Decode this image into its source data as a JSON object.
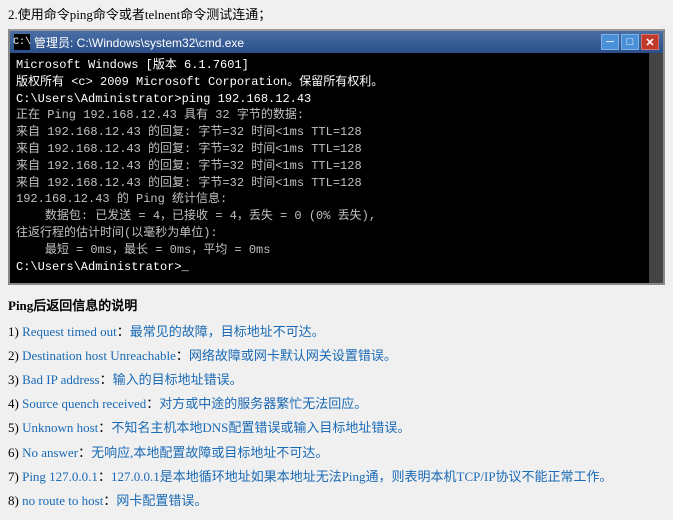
{
  "instruction": "2.使用命令ping命令或者telnent命令测试连通；",
  "window": {
    "title": "管理员: C:\\Windows\\system32\\cmd.exe",
    "content": [
      {
        "text": "Microsoft Windows [版本 6.1.7601]",
        "color": "white"
      },
      {
        "text": "版权所有 <c> 2009 Microsoft Corporation。保留所有权利。",
        "color": "white"
      },
      {
        "text": ""
      },
      {
        "text": "C:\\Users\\Administrator>ping 192.168.12.43",
        "color": "white"
      },
      {
        "text": ""
      },
      {
        "text": "正在 Ping 192.168.12.43 具有 32 字节的数据:",
        "color": "gray"
      },
      {
        "text": "来自 192.168.12.43 的回复: 字节=32 时间<1ms TTL=128",
        "color": "gray"
      },
      {
        "text": "来自 192.168.12.43 的回复: 字节=32 时间<1ms TTL=128",
        "color": "gray"
      },
      {
        "text": "来自 192.168.12.43 的回复: 字节=32 时间<1ms TTL=128",
        "color": "gray"
      },
      {
        "text": "来自 192.168.12.43 的回复: 字节=32 时间<1ms TTL=128",
        "color": "gray"
      },
      {
        "text": ""
      },
      {
        "text": "192.168.12.43 的 Ping 统计信息:",
        "color": "gray"
      },
      {
        "text": "    数据包: 已发送 = 4，已接收 = 4，丢失 = 0 (0% 丢失),",
        "color": "gray"
      },
      {
        "text": "往返行程的估计时间(以毫秒为单位):",
        "color": "gray"
      },
      {
        "text": "    最短 = 0ms，最长 = 0ms，平均 = 0ms",
        "color": "gray"
      },
      {
        "text": ""
      },
      {
        "text": "C:\\Users\\Administrator>_",
        "color": "white"
      }
    ]
  },
  "ping_title": "Ping后返回信息的说明",
  "ping_items": [
    {
      "num": "1)",
      "label": "Request timed out",
      "colon": "：",
      "text": "最常见的故障，目标地址不可达。"
    },
    {
      "num": "2)",
      "label": "Destination host Unreachable",
      "colon": "：",
      "text": "网络故障或网卡默认网关设置错误。"
    },
    {
      "num": "3)",
      "label": "Bad IP address",
      "colon": "：",
      "text": "输入的目标地址错误。"
    },
    {
      "num": "4)",
      "label": "Source quench received",
      "colon": "：",
      "text": "对方或中途的服务器繁忙无法回应。"
    },
    {
      "num": "5)",
      "label": "Unknown host",
      "colon": "：",
      "text": "不知名主机本地DNS配置错误或输入目标地址错误。"
    },
    {
      "num": "6)",
      "label": "No answer",
      "colon": "：",
      "text": "无响应,本地配置故障或目标地址不可达。"
    },
    {
      "num": "7)",
      "label": "Ping 127.0.0.1",
      "colon": "：",
      "text": "127.0.0.1是本地循环地址如果本地址无法Ping通，则表明本机TCP/IP协议不能正常工作。"
    },
    {
      "num": "8)",
      "label": "no route to host",
      "colon": "：",
      "text": "网卡配置错误。"
    }
  ]
}
